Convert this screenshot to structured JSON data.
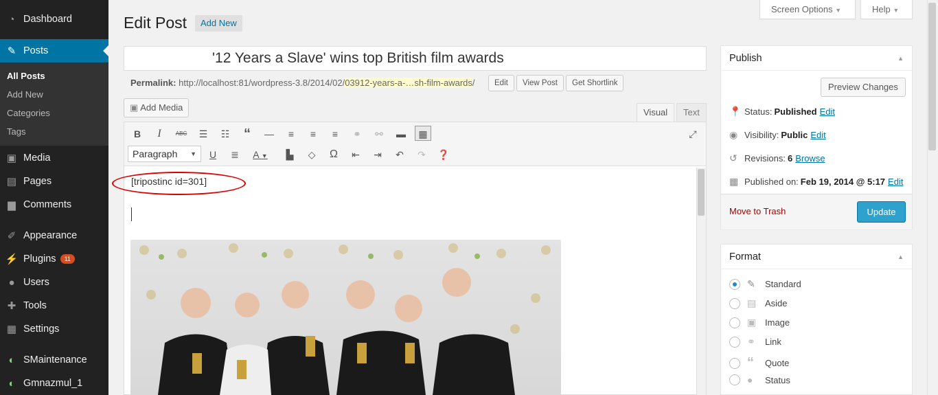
{
  "sidebar": {
    "items": [
      {
        "label": "Dashboard",
        "icon": "dashboard-icon"
      },
      {
        "label": "Posts",
        "icon": "pin-icon"
      },
      {
        "label": "Media",
        "icon": "media-icon"
      },
      {
        "label": "Pages",
        "icon": "pages-icon"
      },
      {
        "label": "Comments",
        "icon": "comments-icon"
      },
      {
        "label": "Appearance",
        "icon": "brush-icon"
      },
      {
        "label": "Plugins",
        "icon": "plugin-icon",
        "badge": "11"
      },
      {
        "label": "Users",
        "icon": "user-icon"
      },
      {
        "label": "Tools",
        "icon": "wrench-icon"
      },
      {
        "label": "Settings",
        "icon": "settings-icon"
      },
      {
        "label": "SMaintenance",
        "icon": "maintenance-icon"
      },
      {
        "label": "Gmnazmul_1",
        "icon": "maintenance-icon"
      }
    ],
    "submenu": [
      "All Posts",
      "Add New",
      "Categories",
      "Tags"
    ]
  },
  "header": {
    "title": "Edit Post",
    "add_new": "Add New",
    "screen_options": "Screen Options",
    "help": "Help"
  },
  "post": {
    "title": "'12 Years a Slave' wins top British film awards",
    "permalink_label": "Permalink:",
    "permalink_base": "http://localhost:81/wordpress-3.8/2014/02/",
    "permalink_slug": "03912-years-a-…sh-film-awards",
    "permalink_end": "/",
    "edit": "Edit",
    "view_post": "View Post",
    "get_shortlink": "Get Shortlink"
  },
  "editor": {
    "add_media": "Add Media",
    "tab_visual": "Visual",
    "tab_text": "Text",
    "format_select": "Paragraph",
    "content_shortcode": "[tripostinc id=301]"
  },
  "publish": {
    "title": "Publish",
    "preview": "Preview Changes",
    "status_label": "Status:",
    "status_value": "Published",
    "visibility_label": "Visibility:",
    "visibility_value": "Public",
    "revisions_label": "Revisions:",
    "revisions_value": "6",
    "browse": "Browse",
    "published_label": "Published on:",
    "published_value": "Feb 19, 2014 @ 5:17",
    "edit": "Edit",
    "trash": "Move to Trash",
    "update": "Update"
  },
  "format": {
    "title": "Format",
    "options": [
      {
        "label": "Standard",
        "icon": "pin-icon",
        "selected": true
      },
      {
        "label": "Aside",
        "icon": "aside-icon",
        "selected": false
      },
      {
        "label": "Image",
        "icon": "image-icon",
        "selected": false
      },
      {
        "label": "Link",
        "icon": "link-icon",
        "selected": false
      },
      {
        "label": "Quote",
        "icon": "quote-icon",
        "selected": false
      },
      {
        "label": "Status",
        "icon": "status-icon",
        "selected": false
      }
    ]
  },
  "colors": {
    "accent": "#0074a2",
    "sidebar": "#222222",
    "update_button": "#2ea2cc",
    "trash": "#a00000"
  }
}
